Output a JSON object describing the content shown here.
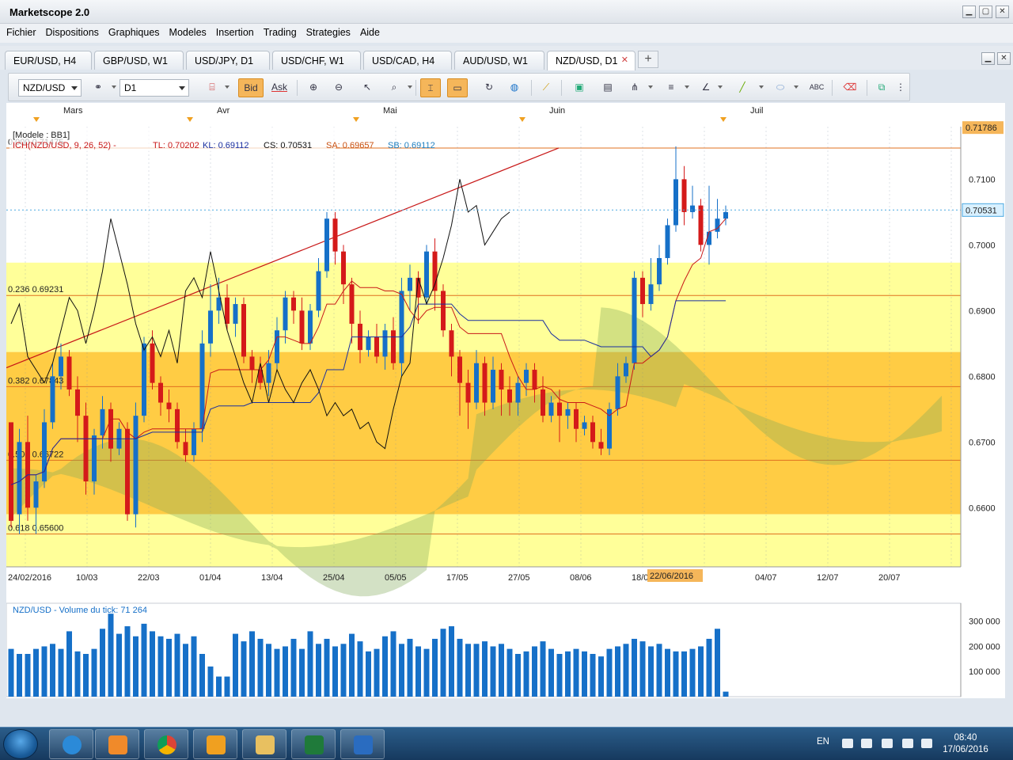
{
  "app": {
    "title": "Marketscope 2.0"
  },
  "menu": [
    "Fichier",
    "Dispositions",
    "Graphiques",
    "Modeles",
    "Insertion",
    "Trading",
    "Strategies",
    "Aide"
  ],
  "tabs": [
    {
      "label": "EUR/USD, H4",
      "active": false
    },
    {
      "label": "GBP/USD, W1",
      "active": false
    },
    {
      "label": "USD/JPY, D1",
      "active": false
    },
    {
      "label": "USD/CHF, W1",
      "active": false
    },
    {
      "label": "USD/CAD, H4",
      "active": false
    },
    {
      "label": "AUD/USD, W1",
      "active": false
    },
    {
      "label": "NZD/USD, D1",
      "active": true
    }
  ],
  "toolbar": {
    "instrument": "NZD/USD",
    "timeframe": "D1",
    "bid_label": "Bid",
    "ask_label": "Ask"
  },
  "legend": {
    "model": "[Modele : BB1]",
    "ichimoku": "ICH(NZD/USD, 9, 26, 52) -",
    "tl": "TL: 0.70202",
    "kl": "KL: 0.69112",
    "cs": "CS: 0.70531",
    "sa": "SA: 0.69657",
    "sb": "SB: 0.69112"
  },
  "fib_labels": [
    "0.000 0.71475",
    "0.236 0.69231",
    "0.382 0.67843",
    "0.500 0.66722",
    "0.618 0.65600"
  ],
  "months": [
    "Mars",
    "Avr",
    "Mai",
    "Juin",
    "Juil"
  ],
  "price_ticks": [
    "0.7100",
    "0.7000",
    "0.6900",
    "0.6800",
    "0.6700",
    "0.6600"
  ],
  "price_tags": {
    "high": "0.71786",
    "last": "0.70531"
  },
  "date_ticks": [
    "24/02/2016",
    "10/03",
    "22/03",
    "01/04",
    "13/04",
    "25/04",
    "05/05",
    "17/05",
    "27/05",
    "08/06",
    "18/0",
    "06",
    "04/07",
    "12/07",
    "20/07"
  ],
  "cursor_date": "22/06/2016",
  "volume": {
    "title": "NZD/USD - Volume du tick: 71 264",
    "ticks": [
      "300 000",
      "200 000",
      "100 000"
    ]
  },
  "colors": {
    "up": "#1670c8",
    "down": "#d41a1a",
    "fib_yellow": "#ffff99",
    "fib_orange": "#ffcc44",
    "accent": "#f5b65a"
  },
  "taskbar": {
    "lang": "EN",
    "time": "08:40",
    "date": "17/06/2016"
  },
  "chart_data": {
    "type": "candlestick",
    "symbol": "NZD/USD",
    "timeframe": "D1",
    "price_range": [
      0.651,
      0.718
    ],
    "fibonacci": [
      {
        "level": "0.000",
        "price": 0.71475
      },
      {
        "level": "0.236",
        "price": 0.69231
      },
      {
        "level": "0.382",
        "price": 0.67843
      },
      {
        "level": "0.500",
        "price": 0.66722
      },
      {
        "level": "0.618",
        "price": 0.656
      }
    ],
    "candles": [
      [
        0.673,
        0.658,
        0.67,
        0.657
      ],
      [
        0.659,
        0.67,
        0.672,
        0.656
      ],
      [
        0.67,
        0.66,
        0.674,
        0.658
      ],
      [
        0.66,
        0.664,
        0.665,
        0.656
      ],
      [
        0.664,
        0.673,
        0.675,
        0.663
      ],
      [
        0.673,
        0.68,
        0.682,
        0.672
      ],
      [
        0.68,
        0.683,
        0.685,
        0.678
      ],
      [
        0.683,
        0.678,
        0.684,
        0.677
      ],
      [
        0.678,
        0.674,
        0.68,
        0.67
      ],
      [
        0.674,
        0.664,
        0.676,
        0.662
      ],
      [
        0.664,
        0.671,
        0.672,
        0.662
      ],
      [
        0.671,
        0.675,
        0.677,
        0.669
      ],
      [
        0.675,
        0.669,
        0.676,
        0.667
      ],
      [
        0.669,
        0.672,
        0.673,
        0.668
      ],
      [
        0.672,
        0.659,
        0.673,
        0.658
      ],
      [
        0.659,
        0.674,
        0.676,
        0.657
      ],
      [
        0.674,
        0.685,
        0.686,
        0.673
      ],
      [
        0.685,
        0.679,
        0.687,
        0.678
      ],
      [
        0.679,
        0.676,
        0.68,
        0.674
      ],
      [
        0.676,
        0.675,
        0.678,
        0.673
      ],
      [
        0.675,
        0.67,
        0.676,
        0.669
      ],
      [
        0.67,
        0.668,
        0.672,
        0.667
      ],
      [
        0.668,
        0.672,
        0.673,
        0.667
      ],
      [
        0.672,
        0.685,
        0.687,
        0.67
      ],
      [
        0.685,
        0.69,
        0.694,
        0.683
      ],
      [
        0.69,
        0.692,
        0.695,
        0.688
      ],
      [
        0.692,
        0.688,
        0.694,
        0.687
      ],
      [
        0.688,
        0.691,
        0.692,
        0.686
      ],
      [
        0.691,
        0.683,
        0.692,
        0.682
      ],
      [
        0.683,
        0.681,
        0.684,
        0.679
      ],
      [
        0.681,
        0.679,
        0.683,
        0.678
      ],
      [
        0.679,
        0.682,
        0.684,
        0.677
      ],
      [
        0.682,
        0.687,
        0.689,
        0.681
      ],
      [
        0.687,
        0.692,
        0.693,
        0.685
      ],
      [
        0.692,
        0.69,
        0.693,
        0.688
      ],
      [
        0.69,
        0.685,
        0.692,
        0.684
      ],
      [
        0.685,
        0.69,
        0.691,
        0.684
      ],
      [
        0.69,
        0.696,
        0.698,
        0.689
      ],
      [
        0.696,
        0.704,
        0.705,
        0.695
      ],
      [
        0.704,
        0.699,
        0.705,
        0.697
      ],
      [
        0.699,
        0.694,
        0.7,
        0.691
      ],
      [
        0.694,
        0.688,
        0.695,
        0.685
      ],
      [
        0.688,
        0.684,
        0.69,
        0.682
      ],
      [
        0.684,
        0.686,
        0.687,
        0.683
      ],
      [
        0.686,
        0.683,
        0.688,
        0.682
      ],
      [
        0.683,
        0.687,
        0.688,
        0.681
      ],
      [
        0.687,
        0.682,
        0.689,
        0.681
      ],
      [
        0.682,
        0.693,
        0.695,
        0.68
      ],
      [
        0.693,
        0.695,
        0.697,
        0.69
      ],
      [
        0.695,
        0.692,
        0.696,
        0.688
      ],
      [
        0.692,
        0.699,
        0.7,
        0.691
      ],
      [
        0.699,
        0.693,
        0.701,
        0.69
      ],
      [
        0.693,
        0.687,
        0.694,
        0.686
      ],
      [
        0.687,
        0.683,
        0.688,
        0.68
      ],
      [
        0.683,
        0.679,
        0.684,
        0.674
      ],
      [
        0.679,
        0.676,
        0.681,
        0.672
      ],
      [
        0.676,
        0.682,
        0.684,
        0.675
      ],
      [
        0.682,
        0.676,
        0.683,
        0.674
      ],
      [
        0.676,
        0.681,
        0.683,
        0.675
      ],
      [
        0.681,
        0.678,
        0.682,
        0.674
      ],
      [
        0.678,
        0.676,
        0.68,
        0.674
      ],
      [
        0.676,
        0.679,
        0.68,
        0.674
      ],
      [
        0.679,
        0.681,
        0.682,
        0.677
      ],
      [
        0.681,
        0.678,
        0.682,
        0.676
      ],
      [
        0.678,
        0.674,
        0.68,
        0.673
      ],
      [
        0.674,
        0.676,
        0.677,
        0.673
      ],
      [
        0.676,
        0.674,
        0.678,
        0.67
      ],
      [
        0.674,
        0.675,
        0.676,
        0.672
      ],
      [
        0.675,
        0.672,
        0.676,
        0.67
      ],
      [
        0.672,
        0.673,
        0.674,
        0.671
      ],
      [
        0.673,
        0.67,
        0.674,
        0.669
      ],
      [
        0.67,
        0.669,
        0.672,
        0.668
      ],
      [
        0.669,
        0.675,
        0.676,
        0.668
      ],
      [
        0.675,
        0.68,
        0.682,
        0.674
      ],
      [
        0.68,
        0.682,
        0.683,
        0.679
      ],
      [
        0.682,
        0.695,
        0.696,
        0.681
      ],
      [
        0.695,
        0.691,
        0.696,
        0.689
      ],
      [
        0.691,
        0.694,
        0.698,
        0.69
      ],
      [
        0.694,
        0.698,
        0.7,
        0.693
      ],
      [
        0.698,
        0.703,
        0.704,
        0.697
      ],
      [
        0.703,
        0.71,
        0.715,
        0.702
      ],
      [
        0.71,
        0.705,
        0.712,
        0.703
      ],
      [
        0.705,
        0.706,
        0.709,
        0.704
      ],
      [
        0.706,
        0.7,
        0.707,
        0.699
      ],
      [
        0.7,
        0.702,
        0.709,
        0.697
      ],
      [
        0.702,
        0.704,
        0.707,
        0.701
      ],
      [
        0.704,
        0.705,
        0.706,
        0.703
      ]
    ],
    "volume": [
      190000,
      170000,
      170000,
      190000,
      200000,
      210000,
      190000,
      260000,
      180000,
      170000,
      190000,
      270000,
      330000,
      250000,
      280000,
      240000,
      290000,
      260000,
      240000,
      230000,
      250000,
      210000,
      240000,
      170000,
      120000,
      80000,
      80000,
      250000,
      220000,
      260000,
      230000,
      210000,
      190000,
      200000,
      230000,
      190000,
      260000,
      210000,
      230000,
      200000,
      210000,
      250000,
      220000,
      180000,
      190000,
      240000,
      260000,
      210000,
      230000,
      200000,
      190000,
      230000,
      270000,
      280000,
      230000,
      210000,
      210000,
      220000,
      200000,
      210000,
      190000,
      170000,
      180000,
      200000,
      220000,
      190000,
      170000,
      180000,
      190000,
      180000,
      170000,
      160000,
      190000,
      200000,
      210000,
      230000,
      220000,
      200000,
      210000,
      190000,
      180000,
      180000,
      190000,
      200000,
      230000,
      270000,
      20000
    ]
  }
}
